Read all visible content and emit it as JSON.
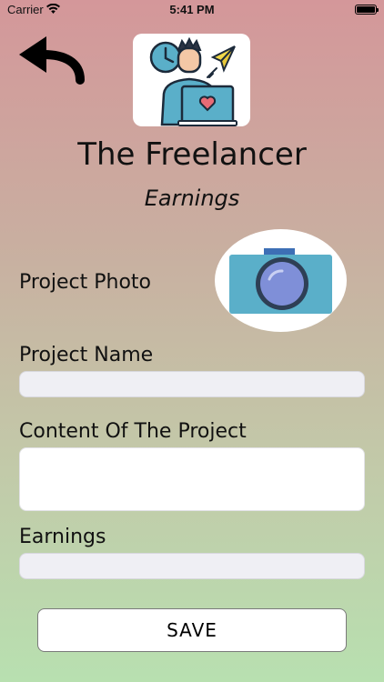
{
  "status_bar": {
    "carrier": "Carrier",
    "time": "5:41 PM"
  },
  "header": {
    "title": "The Freelancer",
    "subtitle": "Earnings"
  },
  "form": {
    "photo_label": "Project Photo",
    "name_label": "Project Name",
    "name_value": "",
    "content_label": "Content Of The Project",
    "content_value": "",
    "earnings_label": "Earnings",
    "earnings_value": ""
  },
  "actions": {
    "save_label": "SAVE"
  },
  "icons": {
    "back": "back-arrow-icon",
    "logo": "freelancer-logo",
    "camera": "camera-icon"
  },
  "colors": {
    "gradient_top": "#d4979a",
    "gradient_bottom": "#b8e0b0",
    "camera_body": "#5aafc9",
    "camera_lens": "#7f8fd8"
  }
}
